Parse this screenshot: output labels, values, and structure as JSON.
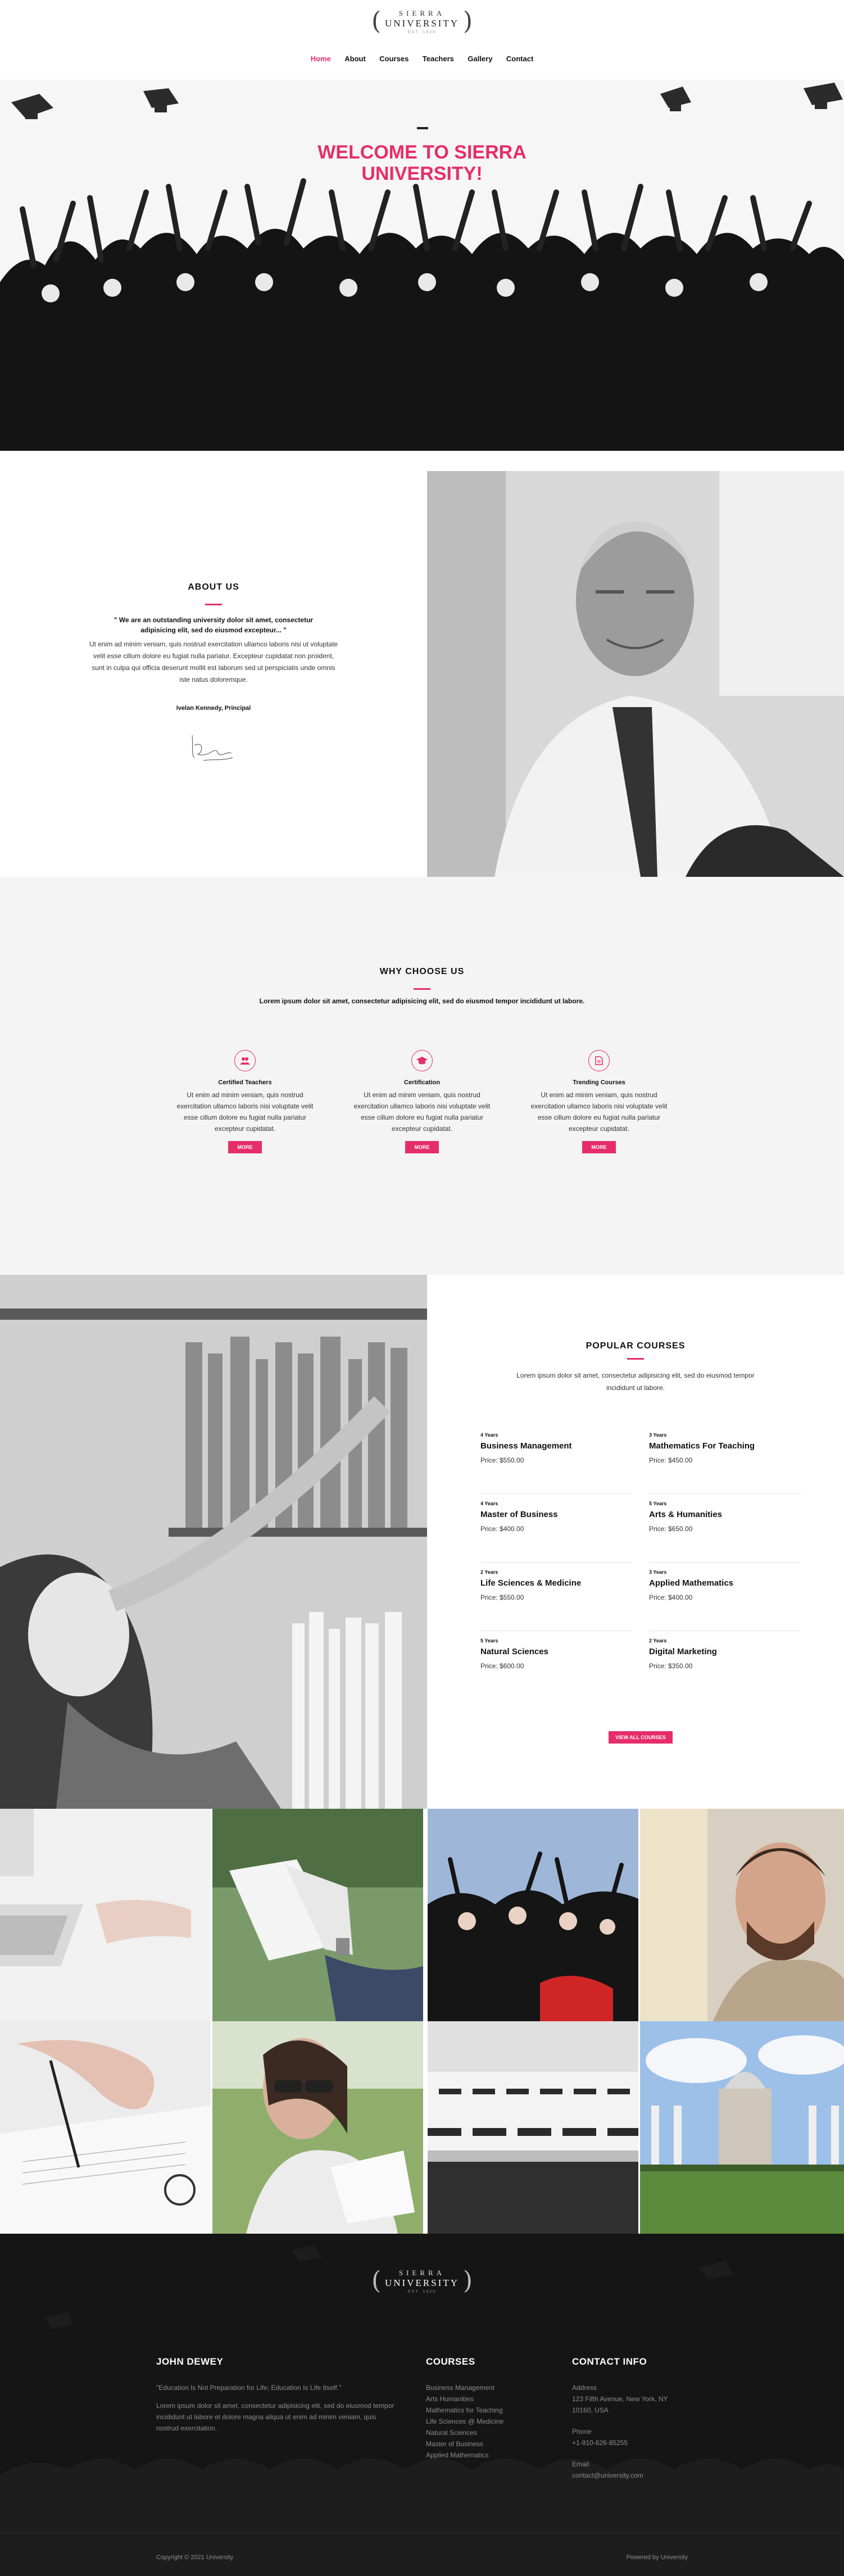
{
  "brand": {
    "top": "SIERRA",
    "name": "UNIVERSITY",
    "est": "EST. 1920"
  },
  "nav": [
    {
      "label": "Home",
      "active": true
    },
    {
      "label": "About"
    },
    {
      "label": "Courses"
    },
    {
      "label": "Teachers"
    },
    {
      "label": "Gallery"
    },
    {
      "label": "Contact"
    }
  ],
  "hero": {
    "title_line1": "WELCOME TO SIERRA",
    "title_line2": "UNIVERSITY!"
  },
  "about": {
    "heading": "ABOUT US",
    "quote": "\" We are an outstanding university dolor sit amet, consectetur adipisicing elit, sed do eiusmod excepteur... \"",
    "body": "Ut enim ad minim veniam, quis nostrud exercitation ullamco laboris nisi ut voluptate velit esse cillum dolore eu fugiat nulla pariatur. Excepteur cupidatat non proident, sunt in culpa qui officia deserunt mollit est laborum sed ut perspiciatis unde omnis iste natus doloremque.",
    "signature": "Ivelan Kennedy, Principal"
  },
  "why": {
    "heading": "WHY CHOOSE US",
    "lead": "Lorem ipsum dolor sit amet, consectetur adipisicing elit, sed do eiusmod tempor incididunt ut labore.",
    "features": [
      {
        "icon": "users-icon",
        "title": "Certified Teachers",
        "text": "Ut enim ad minim veniam, quis nostrud exercitation ullamco laboris nisi voluptate velit esse cillum dolore eu fugiat nulla pariatur excepteur cupidatat.",
        "button": "MORE"
      },
      {
        "icon": "graduation-cap-icon",
        "title": "Certification",
        "text": "Ut enim ad minim veniam, quis nostrud exercitation ullamco laboris nisi voluptate velit esse cillum dolore eu fugiat nulla pariatur excepteur cupidatat.",
        "button": "MORE"
      },
      {
        "icon": "document-icon",
        "title": "Trending Courses",
        "text": "Ut enim ad minim veniam, quis nostrud exercitation ullamco laboris nisi voluptate velit esse cillum dolore eu fugiat nulla pariatur excepteur cupidatat.",
        "button": "MORE"
      }
    ]
  },
  "courses": {
    "heading": "POPULAR COURSES",
    "lead": "Lorem ipsum dolor sit amet, consectetur adipisicing elit, sed do eiusmod tempor incididunt ut labore.",
    "items": [
      {
        "years": "4 Years",
        "name": "Business Management",
        "price": "Price: $550.00"
      },
      {
        "years": "3 Years",
        "name": "Mathematics For Teaching",
        "price": "Price: $450.00"
      },
      {
        "years": "4 Years",
        "name": "Master of Business",
        "price": "Price: $400.00"
      },
      {
        "years": "5 Years",
        "name": "Arts & Humanities",
        "price": "Price: $650.00"
      },
      {
        "years": "2 Years",
        "name": "Life Sciences & Medicine",
        "price": "Price: $550.00"
      },
      {
        "years": "3 Years",
        "name": "Applied Mathematics",
        "price": "Price: $400.00"
      },
      {
        "years": "5 Years",
        "name": "Natural Sciences",
        "price": "Price: $600.00"
      },
      {
        "years": "2 Years",
        "name": "Digital Marketing",
        "price": "Price: $350.00"
      }
    ],
    "view_all": "VIEW ALL COURSES"
  },
  "footer": {
    "col1": {
      "heading": "JOHN DEWEY",
      "quote": "\"Education Is Not Preparation for Life; Education Is Life Itself.\"",
      "text": "Lorem ipsum dolor sit amet, consectetur adipisicing elit, sed do eiusmod tempor incididunt ut labore et dolore magna aliqua ut enim ad minim veniam, quis nostrud exercitation."
    },
    "col2": {
      "heading": "COURSES",
      "links": [
        "Business Management",
        "Arts Humanities",
        "Mathematics for Teaching",
        "Life Sciences @ Medicine",
        "Natural Sciences",
        "Master of Business",
        "Applied Mathematics"
      ]
    },
    "col3": {
      "heading": "CONTACT INFO",
      "address_label": "Address",
      "address_1": "123 Fifth Avenue, New York, NY",
      "address_2": "10160, USA",
      "phone_label": "Phone",
      "phone": "+1-910-626-85255",
      "email_label": "Email",
      "email": "contact@university.com"
    },
    "copyright": "Copyright © 2021 University",
    "powered": "Powered by University"
  }
}
